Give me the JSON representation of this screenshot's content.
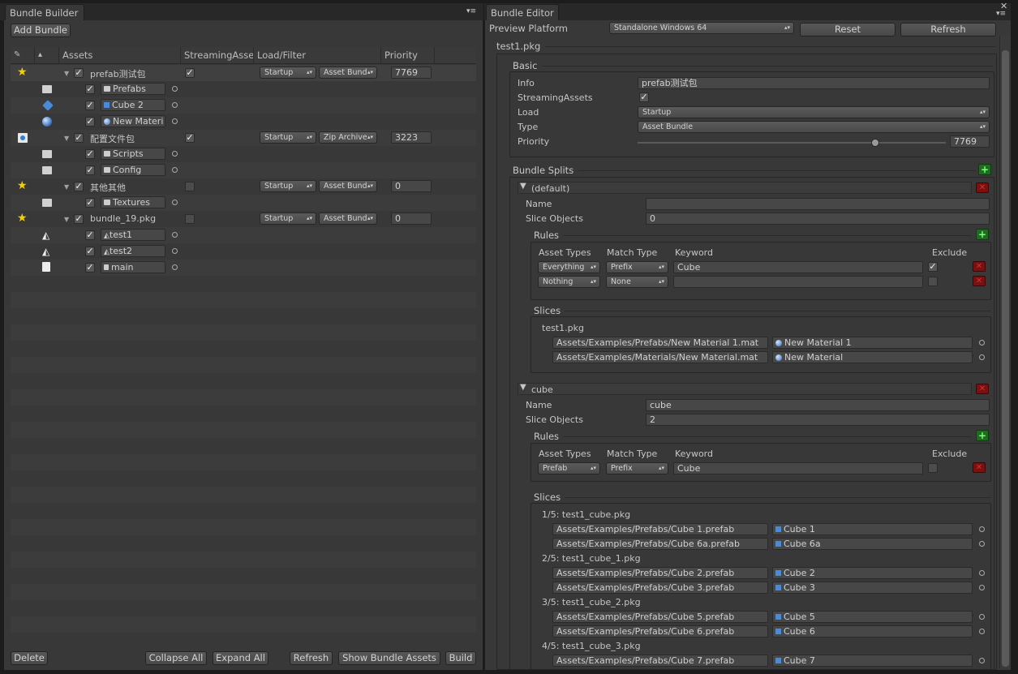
{
  "left": {
    "tab": "Bundle Builder",
    "add_button": "Add Bundle",
    "columns": [
      "Assets",
      "StreamingAsse",
      "Load/Filter",
      "Priority"
    ],
    "b1": {
      "name": "prefab测试包",
      "load": "Startup",
      "type": "Asset Bund",
      "priority": "7769",
      "c1": "Prefabs",
      "c2": "Cube 2",
      "c3": "New Materi"
    },
    "b2": {
      "name": "配置文件包",
      "load": "Startup",
      "type": "Zip Archive",
      "priority": "3223",
      "c1": "Scripts",
      "c2": "Config"
    },
    "b3": {
      "name": "其他其他",
      "load": "Startup",
      "type": "Asset Bund",
      "priority": "0",
      "c1": "Textures"
    },
    "b4": {
      "name": "bundle_19.pkg",
      "load": "Startup",
      "type": "Asset Bund",
      "priority": "0",
      "c1": "test1",
      "c2": "test2",
      "c3": "main"
    },
    "footer": {
      "delete": "Delete",
      "collapse": "Collapse All",
      "expand": "Expand All",
      "refresh": "Refresh",
      "show": "Show Bundle Assets",
      "build": "Build"
    }
  },
  "right": {
    "tab": "Bundle Editor",
    "preview_label": "Preview Platform",
    "platform": "Standalone Windows 64",
    "reset": "Reset",
    "refresh": "Refresh",
    "pkg": "test1.pkg",
    "basic": {
      "title": "Basic",
      "info_l": "Info",
      "info": "prefab测试包",
      "sa_l": "StreamingAssets",
      "load_l": "Load",
      "load": "Startup",
      "type_l": "Type",
      "type": "Asset Bundle",
      "prio_l": "Priority",
      "prio": "7769",
      "prio_fraction": 0.68
    },
    "splits": "Bundle Splits",
    "s1": {
      "title": "(default)",
      "name_l": "Name",
      "name": "",
      "so_l": "Slice Objects",
      "so": "0",
      "rules": "Rules",
      "h_at": "Asset Types",
      "h_mt": "Match Type",
      "h_kw": "Keyword",
      "h_ex": "Exclude",
      "r1": {
        "at": "Everything",
        "mt": "Prefix",
        "kw": "Cube"
      },
      "r2": {
        "at": "Nothing",
        "mt": "None",
        "kw": ""
      },
      "slices": "Slices",
      "pkg": "test1.pkg",
      "sl1": {
        "path": "Assets/Examples/Prefabs/New Material 1.mat",
        "obj": "New Material 1"
      },
      "sl2": {
        "path": "Assets/Examples/Materials/New Material.mat",
        "obj": "New Material"
      }
    },
    "s2": {
      "title": "cube",
      "name_l": "Name",
      "name": "cube",
      "so_l": "Slice Objects",
      "so": "2",
      "rules": "Rules",
      "h_at": "Asset Types",
      "h_mt": "Match Type",
      "h_kw": "Keyword",
      "h_ex": "Exclude",
      "r1": {
        "at": "Prefab",
        "mt": "Prefix",
        "kw": "Cube"
      },
      "slices": "Slices",
      "g1": "1/5: test1_cube.pkg",
      "a1": {
        "path": "Assets/Examples/Prefabs/Cube 1.prefab",
        "obj": "Cube 1"
      },
      "a2": {
        "path": "Assets/Examples/Prefabs/Cube 6a.prefab",
        "obj": "Cube 6a"
      },
      "g2": "2/5: test1_cube_1.pkg",
      "a3": {
        "path": "Assets/Examples/Prefabs/Cube 2.prefab",
        "obj": "Cube 2"
      },
      "a4": {
        "path": "Assets/Examples/Prefabs/Cube 3.prefab",
        "obj": "Cube 3"
      },
      "g3": "3/5: test1_cube_2.pkg",
      "a5": {
        "path": "Assets/Examples/Prefabs/Cube 5.prefab",
        "obj": "Cube 5"
      },
      "a6": {
        "path": "Assets/Examples/Prefabs/Cube 6.prefab",
        "obj": "Cube 6"
      },
      "g4": "4/5: test1_cube_3.pkg",
      "a7": {
        "path": "Assets/Examples/Prefabs/Cube 7.prefab",
        "obj": "Cube 7"
      }
    }
  }
}
